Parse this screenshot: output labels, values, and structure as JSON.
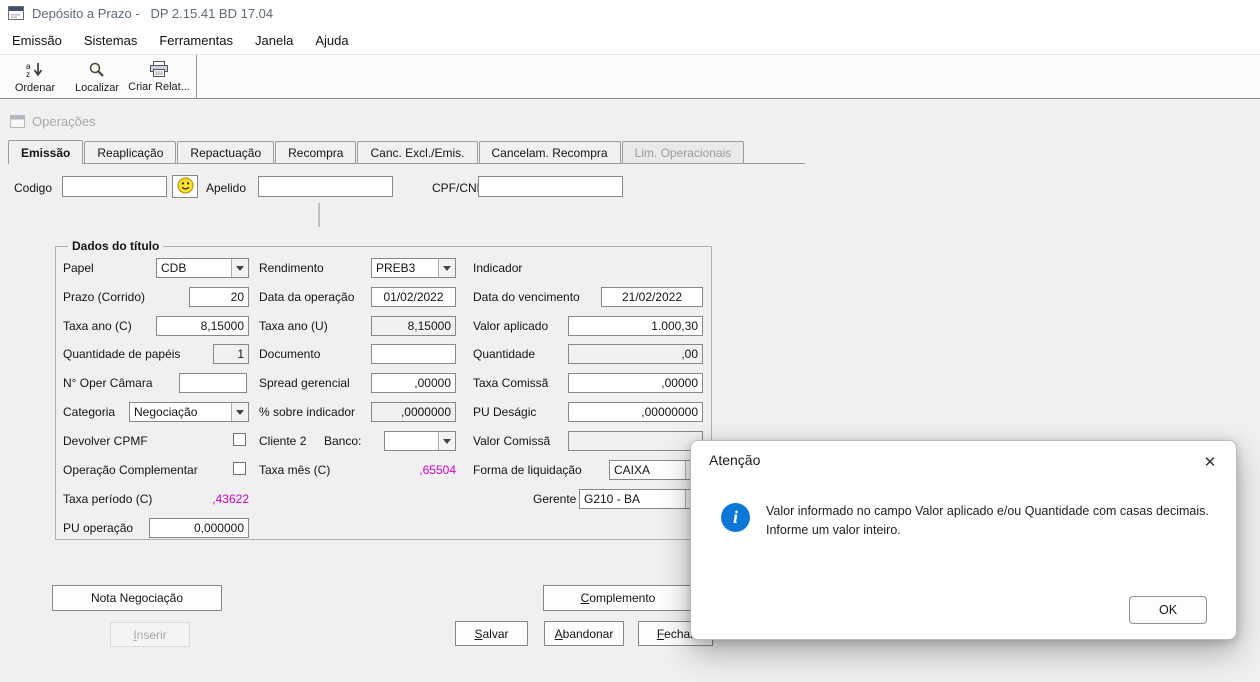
{
  "titlebar": {
    "title": "Depósito a Prazo -   DP 2.15.41 BD 17.04"
  },
  "menubar": {
    "items": [
      "Emissão",
      "Sistemas",
      "Ferramentas",
      "Janela",
      "Ajuda"
    ]
  },
  "toolbar": {
    "buttons": [
      {
        "label": "Ordenar"
      },
      {
        "label": "Localizar"
      },
      {
        "label": "Criar Relat..."
      }
    ]
  },
  "mdi": {
    "title": "Operações"
  },
  "tabs": {
    "items": [
      "Emissão",
      "Reaplicação",
      "Repactuação",
      "Recompra",
      "Canc. Excl./Emis.",
      "Cancelam. Recompra",
      "Lim. Operacionais"
    ]
  },
  "header": {
    "codigo_label": "Codigo",
    "codigo_value": "",
    "apelido_label": "Apelido",
    "apelido_value": "",
    "cpf_label": "CPF/CNPJ",
    "cpf_value": ""
  },
  "dados": {
    "title": "Dados do título",
    "papel_label": "Papel",
    "papel_value": "CDB",
    "rendimento_label": "Rendimento",
    "rendimento_value": "PREB3",
    "indicador_label": "Indicador",
    "prazo_label": "Prazo (Corrido)",
    "prazo_value": "20",
    "data_operacao_label": "Data da operação",
    "data_operacao_value": "01/02/2022",
    "data_vencimento_label": "Data do vencimento",
    "data_vencimento_value": "21/02/2022",
    "taxa_ano_c_label": "Taxa ano (C)",
    "taxa_ano_c_value": "8,15000",
    "taxa_ano_u_label": "Taxa ano (U)",
    "taxa_ano_u_value": "8,15000",
    "valor_aplicado_label": "Valor aplicado",
    "valor_aplicado_value": "1.000,30",
    "qtd_papeis_label": "Quantidade de papéis",
    "qtd_papeis_value": "1",
    "documento_label": "Documento",
    "documento_value": "",
    "quantidade_label": "Quantidade",
    "quantidade_value": ",00",
    "oper_camara_label": "N° Oper Câmara",
    "oper_camara_value": "",
    "spread_label": "Spread gerencial",
    "spread_value": ",00000",
    "taxa_comissao_label": "Taxa Comissã",
    "taxa_comissao_value": ",00000",
    "categoria_label": "Categoria",
    "categoria_value": "Negociação",
    "sobre_indicador_label": "% sobre indicador",
    "sobre_indicador_value": ",0000000",
    "pu_desagio_label": "PU Deságic",
    "pu_desagio_value": ",00000000",
    "devolver_cpmf_label": "Devolver CPMF",
    "cliente2_label": "Cliente 2",
    "banco_label": "Banco:",
    "banco_value": "",
    "valor_comissao_label": "Valor Comissã",
    "valor_comissao_value": "",
    "oper_complementar_label": "Operação Complementar",
    "taxa_mes_label": "Taxa mês (C)",
    "taxa_mes_value": ",65504",
    "forma_liq_label": "Forma de liquidação",
    "forma_liq_value": "CAIXA",
    "taxa_periodo_label": "Taxa período (C)",
    "taxa_periodo_value": ",43622",
    "gerente_label": "Gerente",
    "gerente_value": "G210 - BA",
    "pu_operacao_label": "PU operação",
    "pu_operacao_value": "0,000000"
  },
  "actions": {
    "nota_negociacao": "Nota Negociação",
    "inserir": "Inserir",
    "salvar": "Salvar",
    "abandonar": "Abandonar",
    "fechar": "Fechar",
    "complemento": "Complemento"
  },
  "dialog": {
    "title": "Atenção",
    "icon_glyph": "i",
    "message": "Valor informado no campo Valor aplicado e/ou Quantidade com casas decimais. Informe um valor inteiro.",
    "close_glyph": "✕",
    "ok_label": "OK"
  },
  "colors": {
    "info_blue": "#0b77d7",
    "computed_magenta": "#cc00cc",
    "window_bg": "#f0f0f0"
  }
}
